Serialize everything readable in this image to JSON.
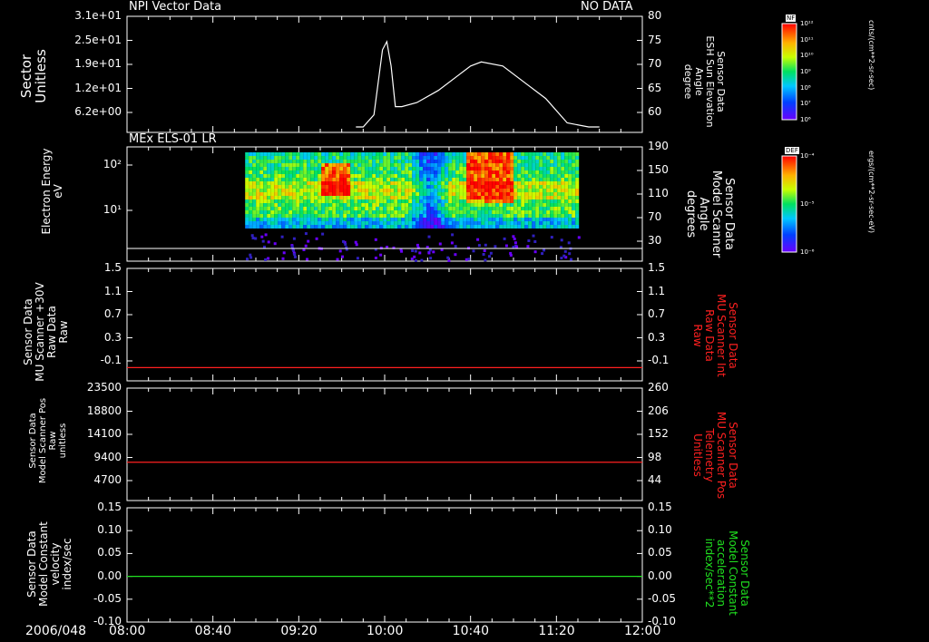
{
  "header": {
    "panel1_title": "NPI Vector Data",
    "no_data": "NO DATA",
    "panel2_title": "MEx ELS-01 LR"
  },
  "time_axis": {
    "date_label": "2006/048",
    "ticks": [
      "08:00",
      "08:40",
      "09:20",
      "10:00",
      "10:40",
      "11:20",
      "12:00"
    ]
  },
  "colors": {
    "background": "#000000",
    "axes": "#ffffff",
    "red_trace": "#ff2020",
    "green_trace": "#20e020"
  },
  "panels": [
    {
      "left_label": "Sector\nUnitless",
      "left_ticks": [
        "3.1e+01",
        "2.5e+01",
        "1.9e+01",
        "1.2e+01",
        "6.2e+00"
      ],
      "right_label": "Sensor Data\nESH Sun Elevation\nAngle\ndegree",
      "right_ticks": [
        "80",
        "75",
        "70",
        "65",
        "60"
      ],
      "colorbar": {
        "title": "NF",
        "unit": "cnts/(cm**2-sr-sec)",
        "ticks": [
          "10¹²",
          "10¹¹",
          "10¹⁰",
          "10⁹",
          "10⁸",
          "10⁷",
          "10⁶"
        ]
      }
    },
    {
      "left_label": "Electron Energy\neV",
      "left_ticks": [
        "10²",
        "10¹"
      ],
      "right_label": "Sensor Data\nModel Scanner\nAngle\ndegrees",
      "right_ticks": [
        "190",
        "150",
        "110",
        "70",
        "30"
      ],
      "colorbar": {
        "title": "DEF",
        "unit": "ergs/(cm**2-sr-sec-eV)",
        "ticks": [
          "10⁻⁴",
          "10⁻⁵",
          "10⁻⁶"
        ]
      }
    },
    {
      "left_label": "Sensor Data\nMU Scanner +30V\nRaw Data\nRaw",
      "left_ticks": [
        "1.5",
        "1.1",
        "0.7",
        "0.3",
        "-0.1"
      ],
      "right_label": "Sensor Data\nMU Scanner Int\nRaw Data\nRaw",
      "right_ticks": [
        "1.5",
        "1.1",
        "0.7",
        "0.3",
        "-0.1"
      ]
    },
    {
      "left_label": "Sensor Data\nModel Scanner Pos\nRaw\nunitless",
      "left_ticks": [
        "23500",
        "18800",
        "14100",
        "9400",
        "4700"
      ],
      "right_label": "Sensor Data\nMU Scanner Pos\nTelemetry\nUnitless",
      "right_ticks": [
        "260",
        "206",
        "152",
        "98",
        "44"
      ]
    },
    {
      "left_label": "Sensor Data\nModel Constant\nvelocity\nindex/sec",
      "left_ticks": [
        "0.15",
        "0.10",
        "0.05",
        "0.00",
        "-0.05",
        "-0.10"
      ],
      "right_label": "Sensor Data\nModel Constant\nacceleration\nindex/sec**2",
      "right_ticks": [
        "0.15",
        "0.10",
        "0.05",
        "0.00",
        "-0.05",
        "-0.10"
      ]
    }
  ],
  "chart_data": [
    {
      "type": "line",
      "title": "NPI Vector Data",
      "series": [
        {
          "name": "Sensor Data ESH Sun Elevation Angle",
          "x": [
            "08:00",
            "08:55",
            "09:50",
            "09:55",
            "09:57",
            "09:59",
            "10:01",
            "10:03",
            "10:05",
            "10:08",
            "10:15",
            "10:25",
            "10:35",
            "10:40",
            "10:45",
            "10:55",
            "11:05",
            "11:15",
            "11:25",
            "11:35",
            "12:00"
          ],
          "y": [
            null,
            null,
            54,
            58,
            66,
            74,
            76,
            70,
            60,
            60,
            61,
            64,
            68,
            70,
            71,
            70,
            66,
            62,
            56,
            52,
            null
          ]
        }
      ],
      "ylabel": "degree",
      "ylim": [
        55,
        80
      ]
    },
    {
      "type": "heatmap",
      "title": "MEx ELS-01 LR",
      "x_range": [
        "08:55",
        "11:30"
      ],
      "y_range_eV": [
        3,
        180
      ],
      "yscale": "log",
      "colorbar": "DEF ergs/(cm**2-sr-sec-eV)",
      "hot_spots": [
        {
          "x": "09:35",
          "note": "red band ~30-80 eV"
        },
        {
          "x": "10:50",
          "note": "red band ~30-150 eV"
        }
      ]
    },
    {
      "type": "line",
      "series": [
        {
          "name": "Sensor Data MU Scanner Int Raw Data",
          "x": [
            "08:00",
            "12:00"
          ],
          "y": [
            0,
            0
          ]
        }
      ],
      "ylim": [
        -0.2,
        1.5
      ]
    },
    {
      "type": "line",
      "series": [
        {
          "name": "Sensor Data MU Scanner Pos Telemetry",
          "x": [
            "08:00",
            "12:00"
          ],
          "y": [
            8000,
            8000
          ]
        }
      ],
      "ylim": [
        0,
        23500
      ]
    },
    {
      "type": "line",
      "series": [
        {
          "name": "Sensor Data Model Constant acceleration",
          "x": [
            "08:00",
            "12:00"
          ],
          "y": [
            0.0,
            0.0
          ]
        }
      ],
      "ylim": [
        -0.1,
        0.15
      ]
    }
  ]
}
